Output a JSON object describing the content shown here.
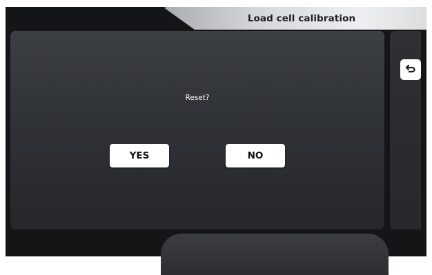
{
  "header": {
    "title": "Load cell calibration"
  },
  "dialog": {
    "prompt": "Reset?",
    "yes_label": "YES",
    "no_label": "NO"
  },
  "side": {
    "back_icon": "return-arrow-icon"
  },
  "colors": {
    "background": "#141517",
    "panel": "#33363b",
    "button": "#ffffff",
    "button_text": "#111111",
    "title_text": "#1e1f21"
  }
}
